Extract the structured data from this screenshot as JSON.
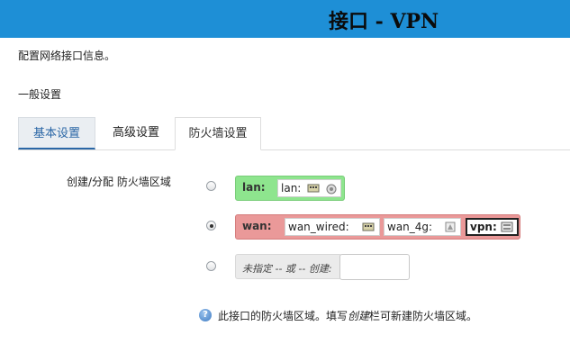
{
  "header": {
    "title": "接口 - VPN"
  },
  "page": {
    "description": "配置网络接口信息。",
    "section_title": "一般设置"
  },
  "tabs": [
    {
      "label": "基本设置"
    },
    {
      "label": "高级设置"
    },
    {
      "label": "防火墙设置"
    }
  ],
  "firewall": {
    "field_label": "创建/分配 防火墙区域",
    "zones": [
      {
        "name": "lan:",
        "color": "#8ee58e",
        "checked": false,
        "networks": [
          {
            "label": "lan:",
            "icons": [
              "switch-icon",
              "wifi-icon"
            ]
          }
        ]
      },
      {
        "name": "wan:",
        "color": "#ea9999",
        "checked": true,
        "networks": [
          {
            "label": "wan_wired:",
            "icons": [
              "switch-icon"
            ]
          },
          {
            "label": "wan_4g:",
            "icons": [
              "device-icon"
            ]
          },
          {
            "label": "vpn:",
            "icons": [
              "network-icon"
            ]
          }
        ]
      }
    ],
    "unspecified_label": "未指定 -- 或 -- 创建:",
    "create_input_value": "",
    "help": {
      "text_before": "此接口的防火墙区域。填写",
      "text_em": "创建",
      "text_after": "栏可新建防火墙区域。"
    }
  }
}
